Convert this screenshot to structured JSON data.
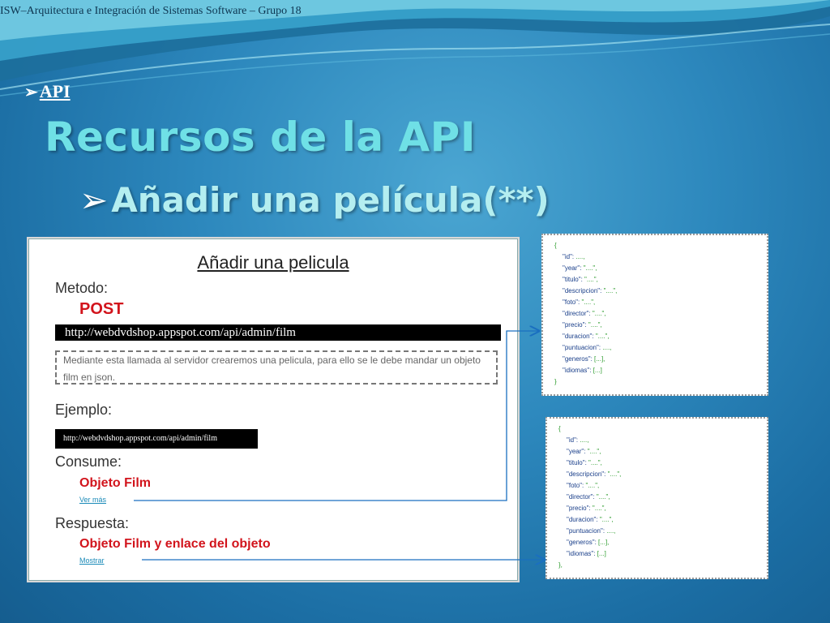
{
  "header": {
    "course_title": "ISW–Arquitectura e Integración de Sistemas Software – Grupo 18"
  },
  "section": {
    "arrow": "➢",
    "label": "API"
  },
  "slide": {
    "title": "Recursos de la API",
    "subtitle_arrow": "➢",
    "subtitle": "Añadir una película(**)"
  },
  "panel": {
    "title": "Añadir una pelicula",
    "metodo_label": "Metodo:",
    "method": "POST",
    "url": "http://webdvdshop.appspot.com/api/admin/film",
    "description": "Mediante esta llamada al servidor crearemos una pelicula, para ello se le debe mandar un objeto film en json.",
    "ejemplo_label": "Ejemplo:",
    "example_url": "http://webdvdshop.appspot.com/api/admin/film",
    "consume_label": "Consume:",
    "consume_value": "Objeto Film",
    "consume_link": "Ver más",
    "respuesta_label": "Respuesta:",
    "respuesta_value": "Objeto Film y enlace del objeto",
    "respuesta_link": "Mostrar"
  },
  "json_request": {
    "open": "{",
    "lines": [
      {
        "key": "\"id\": ",
        "val": "....,"
      },
      {
        "key": "\"year\": ",
        "val": "\"....\","
      },
      {
        "key": "\"titulo\": ",
        "val": "\"....\","
      },
      {
        "key": "\"descripcion\": ",
        "val": "\"....\","
      },
      {
        "key": "\"foto\": ",
        "val": "\"....\","
      },
      {
        "key": "\"director\": ",
        "val": "\"....\","
      },
      {
        "key": "\"precio\": ",
        "val": "\"....\","
      },
      {
        "key": "\"duracion\": ",
        "val": "\"....\","
      },
      {
        "key": "\"puntuacion\": ",
        "val": "....,"
      },
      {
        "key": "\"generos\": ",
        "val": "[...],"
      },
      {
        "key": "\"idiomas\": ",
        "val": "[...]"
      }
    ],
    "close": "}"
  },
  "json_response": {
    "open": "{",
    "lines": [
      {
        "key": "\"id\": ",
        "val": "....,"
      },
      {
        "key": "\"year\": ",
        "val": "\"....\","
      },
      {
        "key": "\"titulo\": ",
        "val": "\"....\","
      },
      {
        "key": "\"descripcion\": ",
        "val": "\"....\","
      },
      {
        "key": "\"foto\": ",
        "val": "\"....\","
      },
      {
        "key": "\"director\": ",
        "val": "\"....\","
      },
      {
        "key": "\"precio\": ",
        "val": "\"....\","
      },
      {
        "key": "\"duracion\": ",
        "val": "\"....\","
      },
      {
        "key": "\"puntuacion\": ",
        "val": "....,"
      },
      {
        "key": "\"generos\": ",
        "val": "[...],"
      },
      {
        "key": "\"idiomas\": ",
        "val": "[...]"
      }
    ],
    "close": "},"
  },
  "colors": {
    "title": "#6fe0e6",
    "subtitle": "#b4eef0",
    "method": "#d2141c",
    "link": "#1a8ab8",
    "json_key": "#1a3f8a",
    "json_value": "#2a9a2a"
  }
}
